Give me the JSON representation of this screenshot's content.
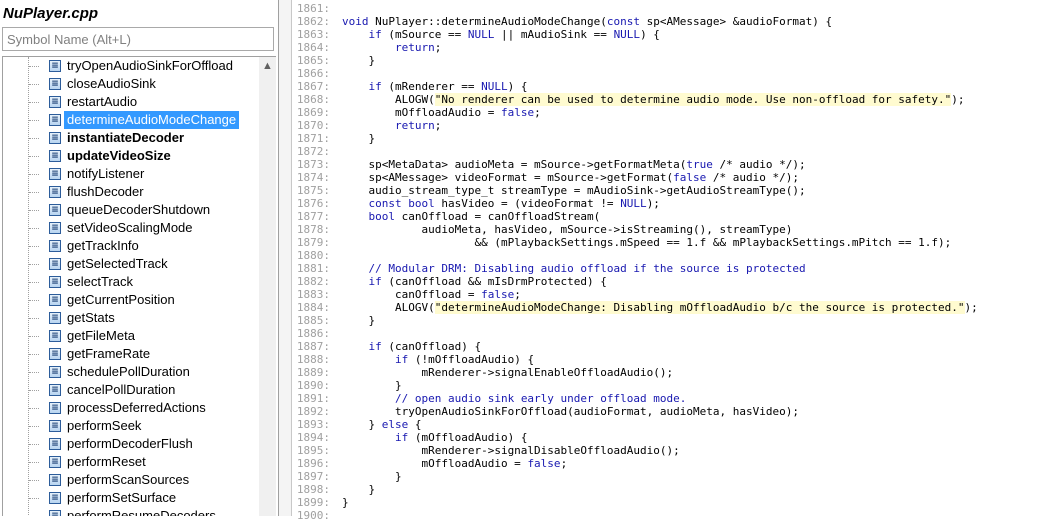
{
  "file_title": "NuPlayer.cpp",
  "search": {
    "placeholder": "Symbol Name (Alt+L)",
    "value": ""
  },
  "symbols": [
    {
      "label": "tryOpenAudioSinkForOffload"
    },
    {
      "label": "closeAudioSink"
    },
    {
      "label": "restartAudio"
    },
    {
      "label": "determineAudioModeChange",
      "selected": true
    },
    {
      "label": "instantiateDecoder",
      "bold": true
    },
    {
      "label": "updateVideoSize",
      "bold": true
    },
    {
      "label": "notifyListener"
    },
    {
      "label": "flushDecoder"
    },
    {
      "label": "queueDecoderShutdown"
    },
    {
      "label": "setVideoScalingMode"
    },
    {
      "label": "getTrackInfo"
    },
    {
      "label": "getSelectedTrack"
    },
    {
      "label": "selectTrack"
    },
    {
      "label": "getCurrentPosition"
    },
    {
      "label": "getStats"
    },
    {
      "label": "getFileMeta"
    },
    {
      "label": "getFrameRate"
    },
    {
      "label": "schedulePollDuration"
    },
    {
      "label": "cancelPollDuration"
    },
    {
      "label": "processDeferredActions"
    },
    {
      "label": "performSeek"
    },
    {
      "label": "performDecoderFlush"
    },
    {
      "label": "performReset"
    },
    {
      "label": "performScanSources"
    },
    {
      "label": "performSetSurface"
    },
    {
      "label": "performResumeDecoders"
    }
  ],
  "icons": {
    "symbol_icon": "function-icon",
    "scroll_up": "chevron-up-icon"
  },
  "code_lines": [
    {
      "n": "1861:",
      "t": ""
    },
    {
      "n": "1862:",
      "t": "void NuPlayer::determineAudioModeChange(const sp<AMessage> &audioFormat) {"
    },
    {
      "n": "1863:",
      "t": "    if (mSource == NULL || mAudioSink == NULL) {"
    },
    {
      "n": "1864:",
      "t": "        return;"
    },
    {
      "n": "1865:",
      "t": "    }"
    },
    {
      "n": "1866:",
      "t": ""
    },
    {
      "n": "1867:",
      "t": "    if (mRenderer == NULL) {"
    },
    {
      "n": "1868:",
      "t": "        ALOGW(\"No renderer can be used to determine audio mode. Use non-offload for safety.\");"
    },
    {
      "n": "1869:",
      "t": "        mOffloadAudio = false;"
    },
    {
      "n": "1870:",
      "t": "        return;"
    },
    {
      "n": "1871:",
      "t": "    }"
    },
    {
      "n": "1872:",
      "t": ""
    },
    {
      "n": "1873:",
      "t": "    sp<MetaData> audioMeta = mSource->getFormatMeta(true /* audio */);"
    },
    {
      "n": "1874:",
      "t": "    sp<AMessage> videoFormat = mSource->getFormat(false /* audio */);"
    },
    {
      "n": "1875:",
      "t": "    audio_stream_type_t streamType = mAudioSink->getAudioStreamType();"
    },
    {
      "n": "1876:",
      "t": "    const bool hasVideo = (videoFormat != NULL);"
    },
    {
      "n": "1877:",
      "t": "    bool canOffload = canOffloadStream("
    },
    {
      "n": "1878:",
      "t": "            audioMeta, hasVideo, mSource->isStreaming(), streamType)"
    },
    {
      "n": "1879:",
      "t": "                    && (mPlaybackSettings.mSpeed == 1.f && mPlaybackSettings.mPitch == 1.f);"
    },
    {
      "n": "1880:",
      "t": ""
    },
    {
      "n": "1881:",
      "t": "    // Modular DRM: Disabling audio offload if the source is protected"
    },
    {
      "n": "1882:",
      "t": "    if (canOffload && mIsDrmProtected) {"
    },
    {
      "n": "1883:",
      "t": "        canOffload = false;"
    },
    {
      "n": "1884:",
      "t": "        ALOGV(\"determineAudioModeChange: Disabling mOffloadAudio b/c the source is protected.\");"
    },
    {
      "n": "1885:",
      "t": "    }"
    },
    {
      "n": "1886:",
      "t": ""
    },
    {
      "n": "1887:",
      "t": "    if (canOffload) {"
    },
    {
      "n": "1888:",
      "t": "        if (!mOffloadAudio) {"
    },
    {
      "n": "1889:",
      "t": "            mRenderer->signalEnableOffloadAudio();"
    },
    {
      "n": "1890:",
      "t": "        }"
    },
    {
      "n": "1891:",
      "t": "        // open audio sink early under offload mode."
    },
    {
      "n": "1892:",
      "t": "        tryOpenAudioSinkForOffload(audioFormat, audioMeta, hasVideo);"
    },
    {
      "n": "1893:",
      "t": "    } else {"
    },
    {
      "n": "1894:",
      "t": "        if (mOffloadAudio) {"
    },
    {
      "n": "1895:",
      "t": "            mRenderer->signalDisableOffloadAudio();"
    },
    {
      "n": "1896:",
      "t": "            mOffloadAudio = false;"
    },
    {
      "n": "1897:",
      "t": "        }"
    },
    {
      "n": "1898:",
      "t": "    }"
    },
    {
      "n": "1899:",
      "t": "}"
    },
    {
      "n": "1900:",
      "t": ""
    }
  ]
}
